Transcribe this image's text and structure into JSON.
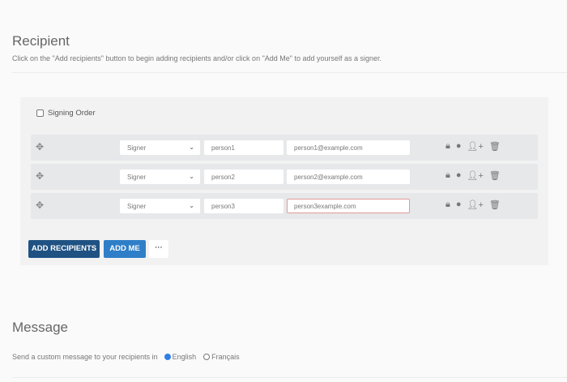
{
  "recipient": {
    "title": "Recipient",
    "description": "Click on the \"Add recipients\" button to begin adding recipients and/or click on \"Add Me\" to add yourself as a signer.",
    "signing_order_label": "Signing Order"
  },
  "rows": [
    {
      "role": "Signer",
      "name": "person1",
      "email": "person1@example.com",
      "invalid": false
    },
    {
      "role": "Signer",
      "name": "person2",
      "email": "person2@example.com",
      "invalid": false
    },
    {
      "role": "Signer",
      "name": "person3",
      "email": "person3example.com",
      "invalid": true
    }
  ],
  "buttons": {
    "add_recipients": "ADD RECIPIENTS",
    "add_me": "ADD ME",
    "more": "···"
  },
  "message": {
    "title": "Message",
    "prompt": "Send a custom message to your recipients in",
    "languages": [
      "English",
      "Français"
    ],
    "selected": "English"
  },
  "colors": {
    "add_recipients": "#1f5283",
    "add_me": "#2f7fc8",
    "error_border": "#e49a9a"
  }
}
